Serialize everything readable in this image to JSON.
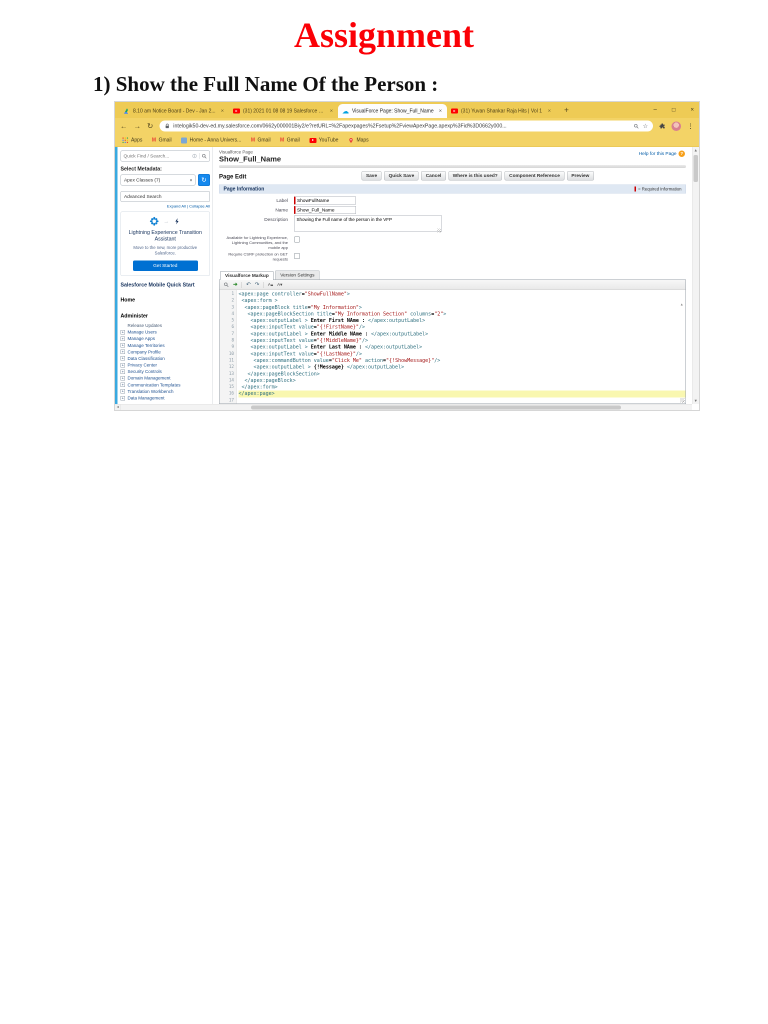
{
  "document": {
    "title": "Assignment",
    "item_heading": "1) Show the Full Name Of the Person :"
  },
  "colors": {
    "chrome_theme_yellow": "#f3d366",
    "salesforce_button_blue": "#0070d2",
    "link_blue": "#015ba7",
    "required_red": "#c00000",
    "code_tag": "#2c6e7e",
    "code_string": "#a31515",
    "editor_highlight": "#f9f7b0"
  },
  "browser": {
    "tabs": [
      {
        "title": "8.10 am Notice Board - Dev - Jan 2...",
        "icon": "drive",
        "active": false
      },
      {
        "title": "(31) 2021 01 08 08 19 Salesforce W...",
        "icon": "youtube",
        "active": false
      },
      {
        "title": "VisualForce Page: Show_Full_Name",
        "icon": "salesforce",
        "active": true
      },
      {
        "title": "(31) Yuvan Shankar Raja Hits | Vol 1",
        "icon": "youtube",
        "active": false
      }
    ],
    "new_tab_label": "+",
    "window_controls": {
      "minimize": "–",
      "maximize": "□",
      "close": "×"
    },
    "url": "intelogik50-dev-ed.my.salesforce.com/0662y000001Biy2/e?retURL=%2Fapexpages%2Fsetup%2FviewApexPage.apexp%3Fid%3D0662y000...",
    "bookmarks": [
      {
        "label": "Apps",
        "icon": "apps-grid"
      },
      {
        "label": "Gmail",
        "icon": "gmail"
      },
      {
        "label": "Home - Anna Univers...",
        "icon": "site"
      },
      {
        "label": "Gmail",
        "icon": "gmail"
      },
      {
        "label": "Gmail",
        "icon": "gmail"
      },
      {
        "label": "YouTube",
        "icon": "youtube"
      },
      {
        "label": "Maps",
        "icon": "maps"
      }
    ]
  },
  "sidebar": {
    "search_placeholder": "Quick Find / Search...",
    "select_metadata_label": "Select Metadata:",
    "metadata_value": "Apex Classes (7)",
    "advanced_search": "Advanced Search",
    "expand_collapse": "Expand All | Collapse All",
    "assistant": {
      "title": "Lightning Experience Transition Assistant",
      "subtitle": "Move to the new, more productive Salesforce.",
      "button": "Get Started"
    },
    "quick_start": "Salesforce Mobile Quick Start",
    "home": "Home",
    "administer": "Administer",
    "admin_items": [
      {
        "label": "Release Updates",
        "expandable": false
      },
      {
        "label": "Manage Users",
        "expandable": true
      },
      {
        "label": "Manage Apps",
        "expandable": true
      },
      {
        "label": "Manage Territories",
        "expandable": true
      },
      {
        "label": "Company Profile",
        "expandable": true
      },
      {
        "label": "Data Classification",
        "expandable": true
      },
      {
        "label": "Privacy Center",
        "expandable": true
      },
      {
        "label": "Security Controls",
        "expandable": true
      },
      {
        "label": "Domain Management",
        "expandable": true
      },
      {
        "label": "Communication Templates",
        "expandable": true
      },
      {
        "label": "Translation Workbench",
        "expandable": true
      },
      {
        "label": "Data Management",
        "expandable": true
      }
    ]
  },
  "main": {
    "page_type_label": "Visualforce Page",
    "page_title": "Show_Full_Name",
    "help_link": "Help for this Page",
    "section_title": "Page Edit",
    "buttons": [
      "Save",
      "Quick Save",
      "Cancel",
      "Where is this used?",
      "Component Reference",
      "Preview"
    ],
    "page_information": "Page Information",
    "required_info": "= Required Information",
    "fields": {
      "label_caption": "Label",
      "label_value": "ShowFullName",
      "name_caption": "Name",
      "name_value": "Show_Full_Name",
      "description_caption": "Description",
      "description_value": "Showing the Full name of the person in the VFP",
      "checkbox1_label": "Available for Lightning Experience, Lightning Communities, and the mobile app",
      "checkbox1_checked": false,
      "checkbox2_label": "Require CSRF protection on GET requests",
      "checkbox2_checked": false
    },
    "markup_tabs": [
      {
        "label": "Visualforce Markup",
        "active": true
      },
      {
        "label": "Version Settings",
        "active": false
      }
    ],
    "editor": {
      "highlighted_line": 16,
      "lines": [
        "<apex:page controller=\"ShowFullName\">",
        " <apex:form >",
        "  <apex:pageBlock title=\"My Information\">",
        "   <apex:pageBlockSection title=\"My Information Section\" columns=\"2\">",
        "    <apex:outputLabel > Enter First NAme : </apex:outputLabel>",
        "    <apex:inputText value=\"{!FirstName}\"/>",
        "    <apex:outputLabel > Enter Middle NAme : </apex:outputLabel>",
        "    <apex:inputText value=\"{!MiddleName}\"/>",
        "    <apex:outputLabel > Enter Last NAme : </apex:outputLabel>",
        "    <apex:inputText value=\"{!LastName}\"/>",
        "     <apex:commandButton value=\"Click Me\" action=\"{!ShowMessage}\"/>",
        "     <apex:outputLabel > {!Message} </apex:outputLabel>",
        "   </apex:pageBlockSection>",
        "  </apex:pageBlock>",
        " </apex:form>",
        "</apex:page>",
        ""
      ]
    }
  }
}
